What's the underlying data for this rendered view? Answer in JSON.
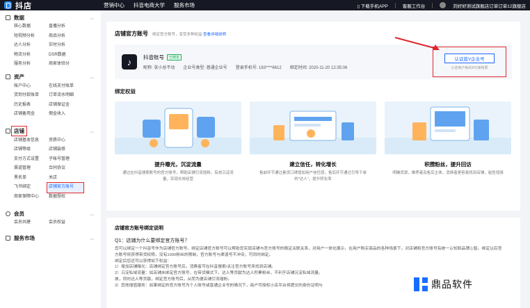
{
  "topbar": {
    "logo_text": "抖店",
    "nav": [
      "营销中心",
      "抖音电商大学",
      "服务市场"
    ],
    "download": "下载手机APP",
    "workbench": "客服工作台",
    "shop_name": "刘好好测试旗舰店订单订单12旗舰店"
  },
  "sidebar": {
    "data": {
      "title": "数据",
      "items": [
        "核心数据",
        "直播分析",
        "短视频分析",
        "商品分析",
        "达人分析",
        "实时分析",
        "物流分析",
        "DSR数据",
        "服务分析",
        "商家体验分"
      ]
    },
    "assets": {
      "title": "资产",
      "items": [
        "账户中心",
        "在线支付账单",
        "货到付款账单",
        "订单流水明细",
        "历史报表",
        "店铺保证金",
        "店铺备用金",
        "佣金收入"
      ]
    },
    "shop": {
      "title": "店铺",
      "items": [
        "店铺基本信息",
        "资质中心",
        "店铺等级",
        "店铺装修",
        "支付方式设置",
        "子账号管理",
        "渠道管理",
        "合同协议",
        "黑名单",
        "关店",
        "飞书绑定",
        "店铺官方账号",
        "商家保障中心",
        "数据授权"
      ]
    },
    "member": {
      "title": "会员",
      "items": [
        "会员共建",
        "会员权益"
      ]
    },
    "service": {
      "title": "服务市场"
    }
  },
  "card1": {
    "title": "店铺官方账号",
    "subtitle": "绑定官方账号，享受多种权益",
    "detail_link": "查看详细说明",
    "account": {
      "name": "抖音账号",
      "tag": "已绑定",
      "nickname": "昵称: 张小总不动",
      "enterprise_type": "企业号类型: 普通企业号",
      "phone": "登录手机号: 183****6612",
      "bind_time": "绑定时间: 2020-11-20 12:35:06"
    },
    "cert_button": "认证蓝V企业号",
    "cert_note": "小店用户免600元审核费",
    "benefits_label": "绑定权益",
    "benefits": [
      {
        "title": "提升曝光，沉淀流量",
        "desc": "通过在抖音搜索账号的官方账号，帮助店铺引流增粉，有效沉淀流量，实现长效经营"
      },
      {
        "title": "建立信任，转化增长",
        "desc": "售前环节通过素货口碑增加用户信任感，售后环节通过引导下单的\"达人\"，提升转化率"
      },
      {
        "title": "积攒粉丝，提升回访",
        "desc": "明确货源，推荐者及售后主体，消费者更容易找到店铺，粘性增强"
      }
    ]
  },
  "card2": {
    "title": "店铺官方账号绑定说明",
    "q1": "Q1：店铺为什么要绑定官方账号？",
    "paragraphs": [
      "您可以绑定一个抖音号作为店铺官方账号。绑定店铺官方账号可以帮助您实现店铺与官方账号的稳定关联关系，对用户一体化展示，在用户购买商品的各种场景下，对店铺和官方账号有统一认知和品牌心智。绑定以后官方账号将获得带货权限，没有1000粉丝的限制，官方账号与渠道号不冲突，可同时绑定。",
      "绑定后您还可以获得如下权益：",
      "1）增加店铺曝光：店铺绑定官方账号后，消费者可在抖音搜索/关注官方账号来找到店铺。",
      "2）沉淀私域流量：如店铺未绑定官方账号，在带货模式下，达人等贡献为达人积累粉丝，不利于店铺沉淀私域流量。",
      "故，同时达人等贡献，绑定官方账号后，从而为便店铺引流增粉。",
      "3）其他增值服务：如果绑定的官方账号为个人账号或普通企业号的情况下，商户可授权小店平台将提交的身份证明与"
    ]
  },
  "watermark": "鼎品软件"
}
